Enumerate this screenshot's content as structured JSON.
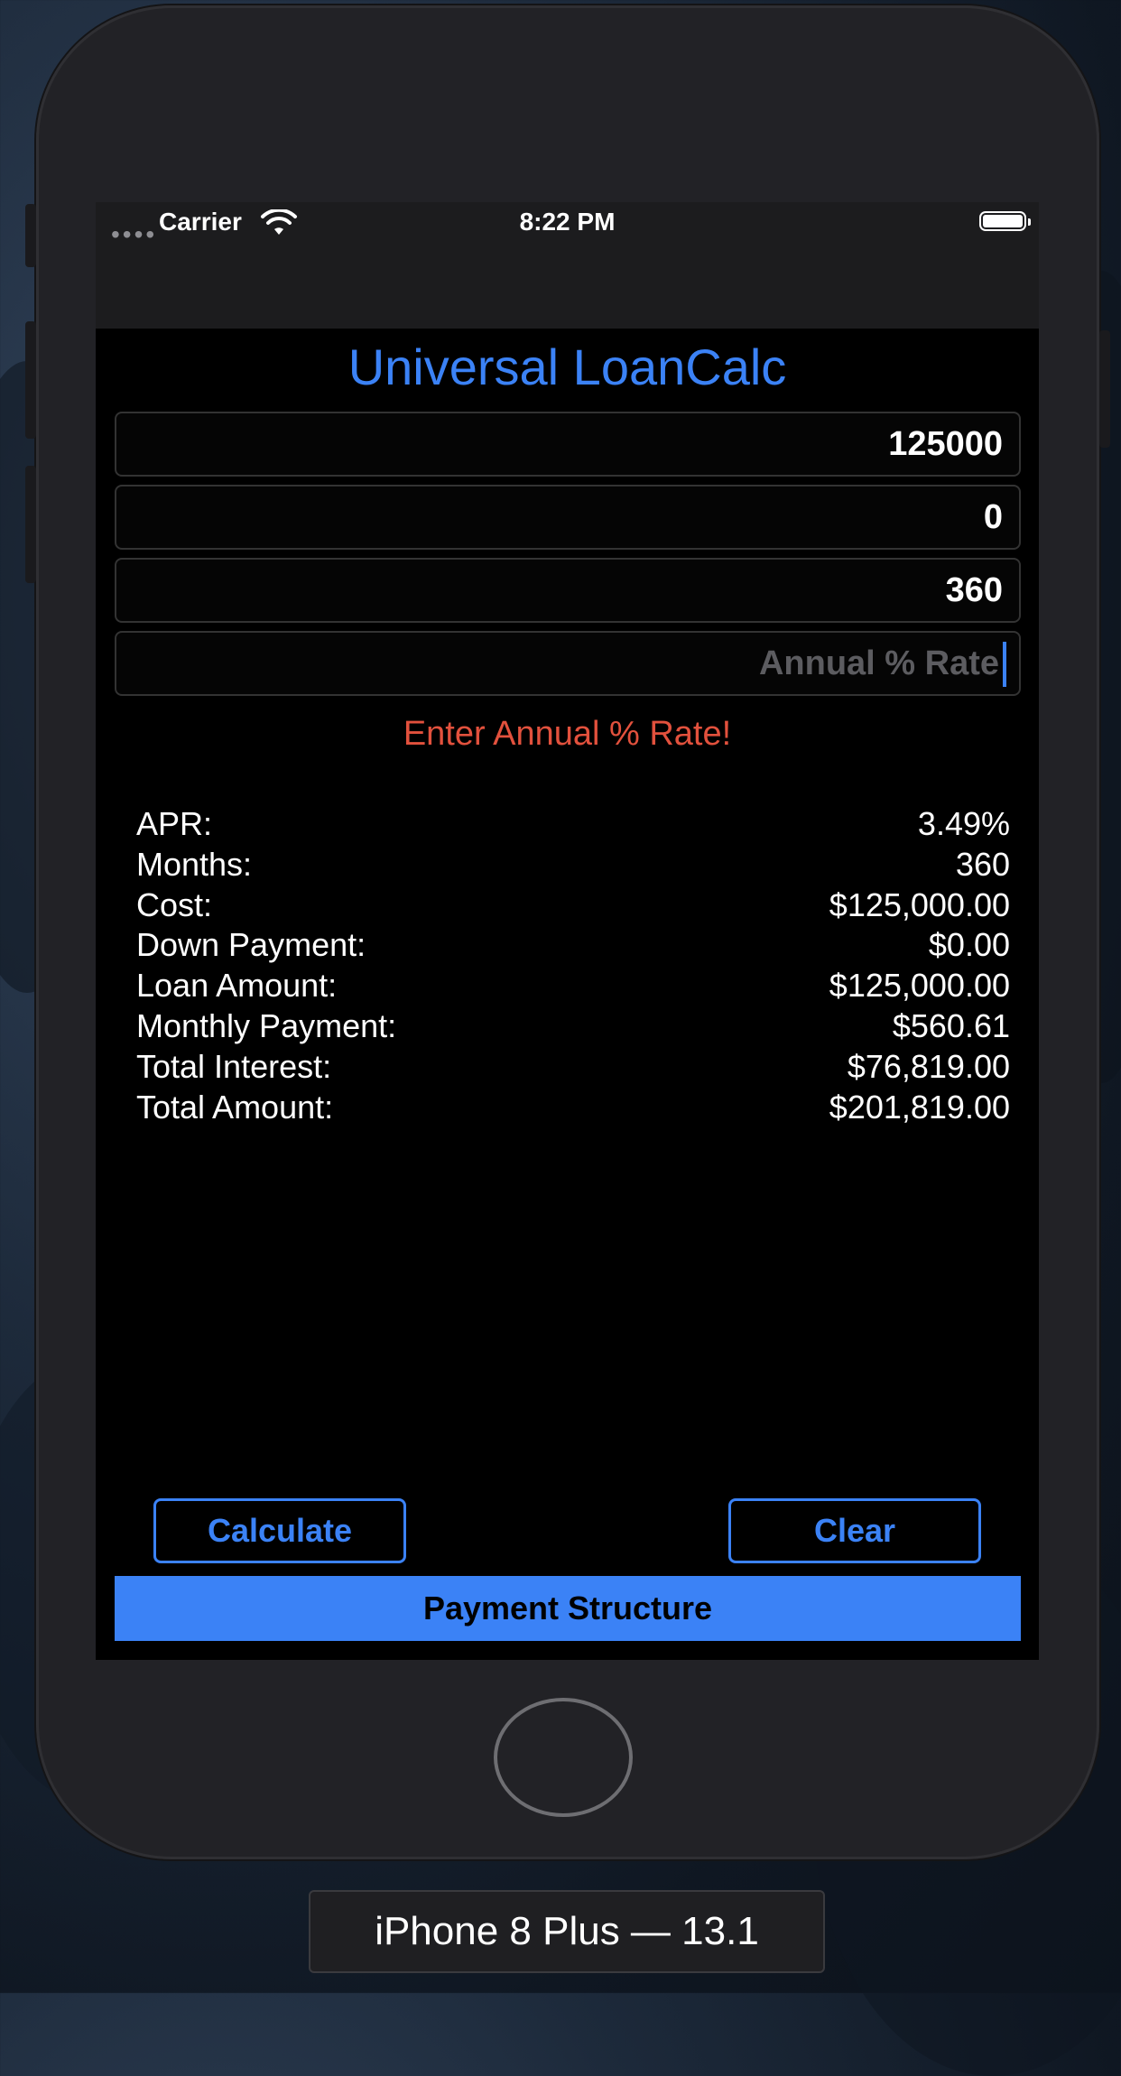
{
  "status_bar": {
    "carrier": "Carrier",
    "time": "8:22 PM"
  },
  "app": {
    "title": "Universal LoanCalc",
    "fields": {
      "cost": "125000",
      "down_payment": "0",
      "months": "360",
      "rate_placeholder": "Annual % Rate"
    },
    "error_message": "Enter Annual % Rate!",
    "results": [
      {
        "label": "APR:",
        "value": "3.49%"
      },
      {
        "label": "Months:",
        "value": "360"
      },
      {
        "label": "Cost:",
        "value": "$125,000.00"
      },
      {
        "label": "Down Payment:",
        "value": "$0.00"
      },
      {
        "label": "Loan Amount:",
        "value": "$125,000.00"
      },
      {
        "label": "Monthly Payment:",
        "value": "$560.61"
      },
      {
        "label": "Total Interest:",
        "value": "$76,819.00"
      },
      {
        "label": "Total Amount:",
        "value": "$201,819.00"
      }
    ],
    "buttons": {
      "calculate": "Calculate",
      "clear": "Clear",
      "payment_structure": "Payment Structure"
    }
  },
  "simulator": {
    "device_label": "iPhone 8 Plus — 13.1"
  },
  "colors": {
    "accent": "#3b82f6",
    "error": "#e2513d"
  }
}
